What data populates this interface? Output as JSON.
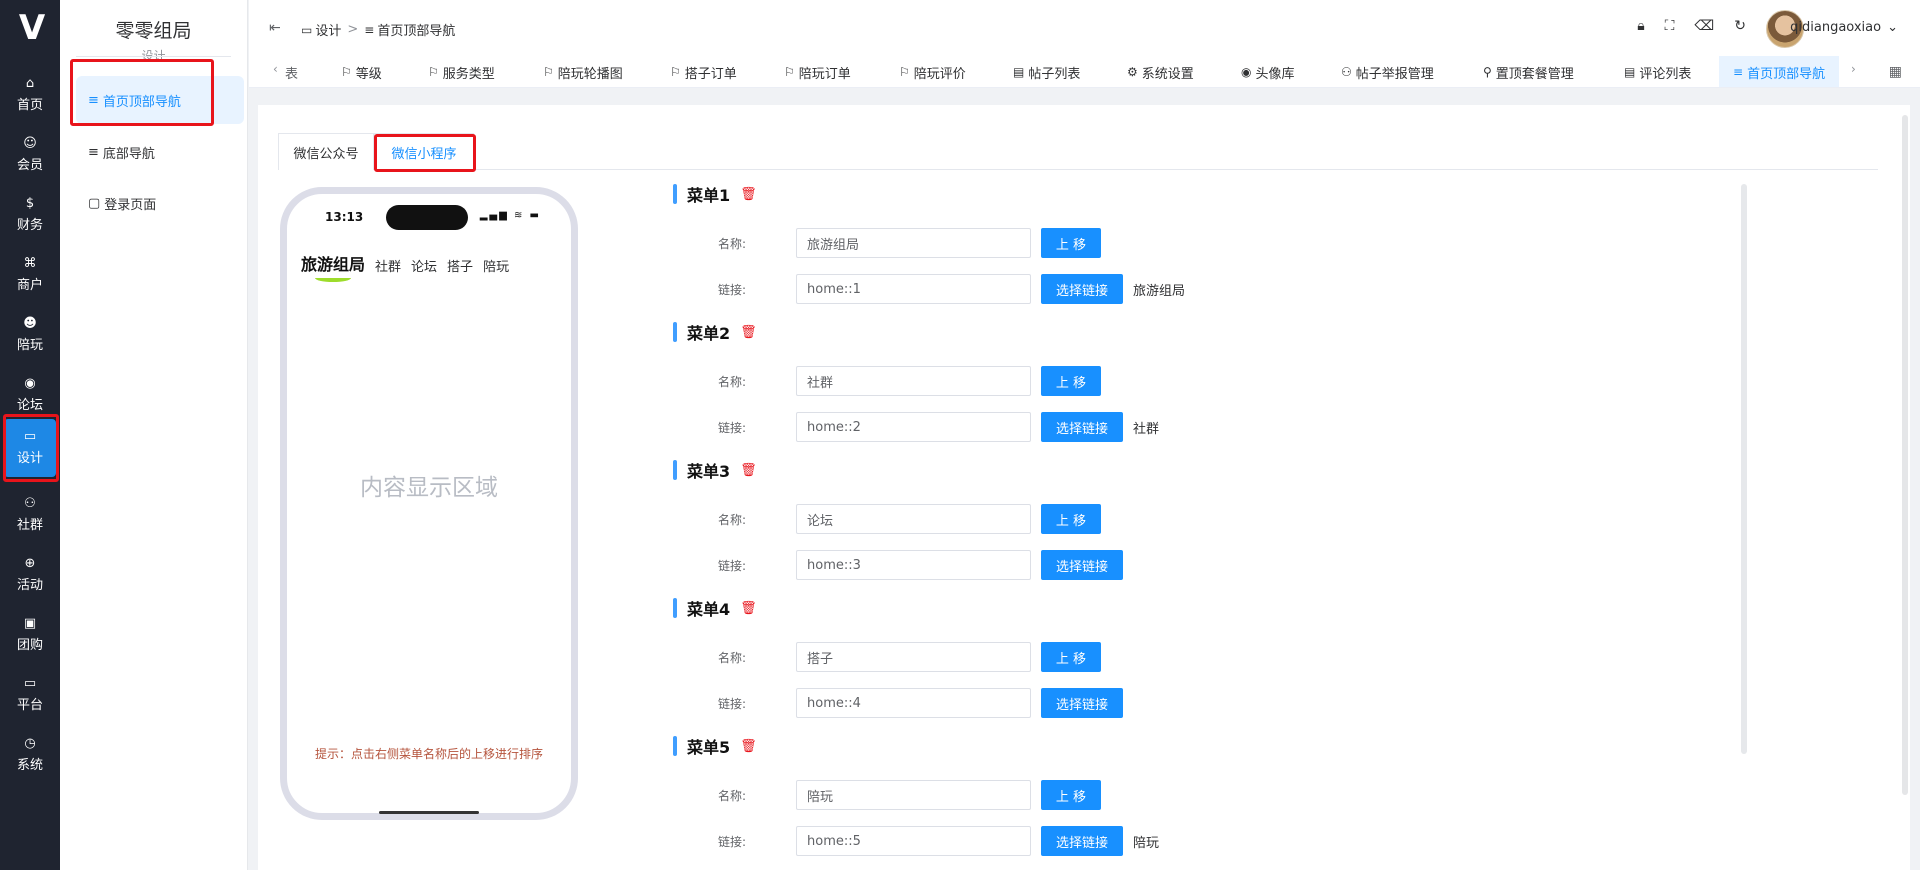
{
  "rail": {
    "items": [
      {
        "label": "首页",
        "icon": "⌂"
      },
      {
        "label": "会员",
        "icon": "☺"
      },
      {
        "label": "财务",
        "icon": "$"
      },
      {
        "label": "商户",
        "icon": "⌘"
      },
      {
        "label": "陪玩",
        "icon": "☻"
      },
      {
        "label": "论坛",
        "icon": "◉"
      },
      {
        "label": "设计",
        "icon": "▭"
      },
      {
        "label": "社群",
        "icon": "⚇"
      },
      {
        "label": "活动",
        "icon": "⊕"
      },
      {
        "label": "团购",
        "icon": "▣"
      },
      {
        "label": "平台",
        "icon": "▭"
      },
      {
        "label": "系统",
        "icon": "◷"
      }
    ]
  },
  "submenu": {
    "title": "零零组局",
    "subtitle": "设计",
    "items": [
      {
        "label": "首页顶部导航",
        "icon": "≡"
      },
      {
        "label": "底部导航",
        "icon": "≡"
      },
      {
        "label": "登录页面",
        "icon": "▢"
      }
    ]
  },
  "header": {
    "breadcrumb": [
      "设计",
      "首页顶部导航"
    ],
    "username": "qidiangaoxiao"
  },
  "tagbar": {
    "tags": [
      {
        "label": "等级"
      },
      {
        "label": "服务类型"
      },
      {
        "label": "陪玩轮播图"
      },
      {
        "label": "搭子订单"
      },
      {
        "label": "陪玩订单"
      },
      {
        "label": "陪玩评价"
      },
      {
        "label": "帖子列表"
      },
      {
        "label": "系统设置"
      },
      {
        "label": "头像库"
      },
      {
        "label": "帖子举报管理"
      },
      {
        "label": "置顶套餐管理"
      },
      {
        "label": "评论列表"
      },
      {
        "label": "首页顶部导航"
      }
    ],
    "clipped_tag": "表"
  },
  "tabs": [
    "微信公众号",
    "微信小程序"
  ],
  "phone": {
    "time": "13:13",
    "status_icons": "▂▄▆ ≋ ▬",
    "brand": "旅游组局",
    "nav": [
      "社群",
      "论坛",
      "搭子",
      "陪玩"
    ],
    "content": "内容显示区域",
    "hint": "提示：点击右侧菜单名称后的上移进行排序"
  },
  "form": {
    "name_label": "名称:",
    "link_label": "链接:",
    "up_label": "上 移",
    "choose_label": "选择链接"
  },
  "menus": [
    {
      "title": "菜单1",
      "name": "旅游组局",
      "link": "home::1",
      "link_name": "旅游组局"
    },
    {
      "title": "菜单2",
      "name": "社群",
      "link": "home::2",
      "link_name": "社群"
    },
    {
      "title": "菜单3",
      "name": "论坛",
      "link": "home::3",
      "link_name": ""
    },
    {
      "title": "菜单4",
      "name": "搭子",
      "link": "home::4",
      "link_name": ""
    },
    {
      "title": "菜单5",
      "name": "陪玩",
      "link": "home::5",
      "link_name": "陪玩"
    }
  ],
  "colors": {
    "accent": "#1890ff",
    "rail_bg": "#1f2430",
    "highlight_red": "#e8141b",
    "delete_red": "#e8141b"
  }
}
